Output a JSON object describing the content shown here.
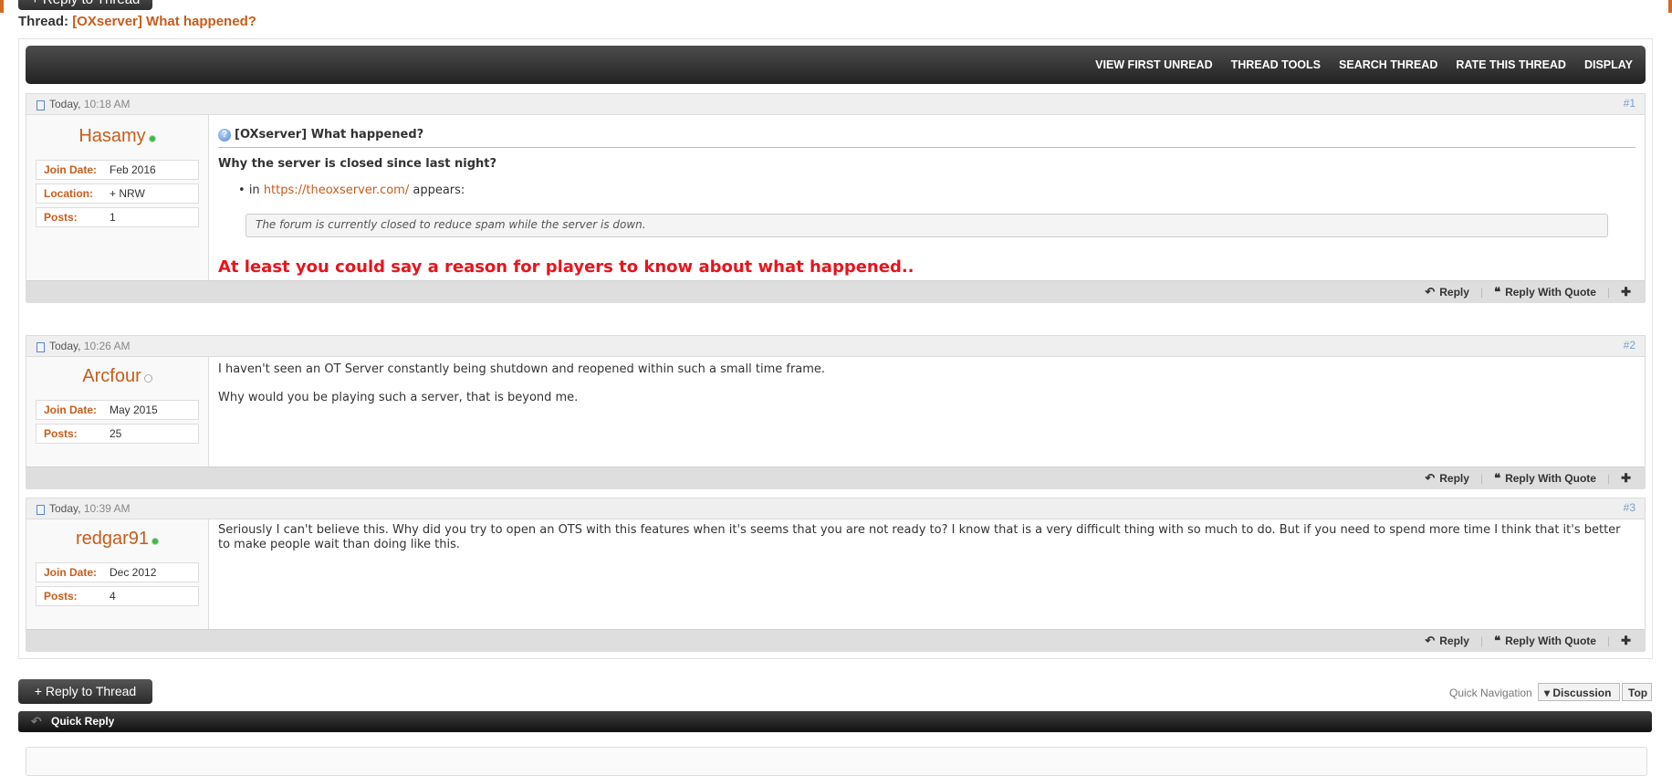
{
  "header": {
    "top_reply_label": "+ Reply to Thread",
    "thread_prefix": "Thread:",
    "thread_title": "[OXserver] What happened?"
  },
  "toolbar": {
    "items": [
      "VIEW FIRST UNREAD",
      "THREAD TOOLS",
      "SEARCH THREAD",
      "RATE THIS THREAD",
      "DISPLAY"
    ]
  },
  "posts": [
    {
      "day": "Today,",
      "time": "10:18 AM",
      "number": "#1",
      "username": "Hasamy",
      "online": true,
      "info": [
        {
          "label": "Join Date:",
          "value": "Feb 2016"
        },
        {
          "label": "Location:",
          "value": "+ NRW"
        },
        {
          "label": "Posts:",
          "value": "1"
        }
      ],
      "title": "[OXserver] What happened?",
      "question": "Why the server is closed since last night?",
      "list_prefix": "in",
      "link": "https://theoxserver.com/",
      "list_suffix": "appears:",
      "quote": "The forum is currently closed to reduce spam while the server is down.",
      "emphasis": "At least you could say a reason for players to know about what happened.."
    },
    {
      "day": "Today,",
      "time": "10:26 AM",
      "number": "#2",
      "username": "Arcfour",
      "online": false,
      "info": [
        {
          "label": "Join Date:",
          "value": "May 2015"
        },
        {
          "label": "Posts:",
          "value": "25"
        }
      ],
      "line1": "I haven't seen an OT Server constantly being shutdown and reopened within such a small time frame.",
      "line2": "Why would you be playing such a server, that is beyond me."
    },
    {
      "day": "Today,",
      "time": "10:39 AM",
      "number": "#3",
      "username": "redgar91",
      "online": true,
      "info": [
        {
          "label": "Join Date:",
          "value": "Dec 2012"
        },
        {
          "label": "Posts:",
          "value": "4"
        }
      ],
      "text": "Seriously I can't believe this. Why did you try to open an OTS with this features when it's seems that you are not ready to? I know that is a very difficult thing with so much to do. But if you need to spend more time I think that it's better to make people wait than doing like this."
    }
  ],
  "post_actions": {
    "reply": "Reply",
    "reply_with_quote": "Reply With Quote",
    "multi_quote_icon": "multi-quote-icon"
  },
  "footer": {
    "reply_label": "+ Reply to Thread",
    "quick_navigation": "Quick Navigation",
    "discussion": "Discussion",
    "top": "Top",
    "quick_reply": "Quick Reply"
  },
  "colors": {
    "accent": "#c65d1b",
    "emphasis_red": "#e8141c",
    "toolbar_dark": "#2e2e2e"
  }
}
